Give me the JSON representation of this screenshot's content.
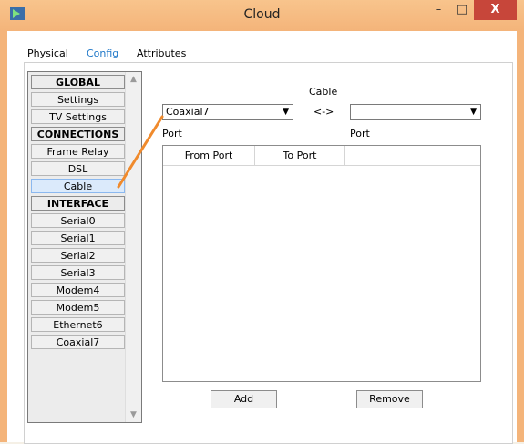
{
  "window": {
    "title": "Cloud",
    "minimize_glyph": "–",
    "maximize_glyph": "□",
    "close_glyph": "X"
  },
  "tabs": [
    {
      "label": "Physical"
    },
    {
      "label": "Config",
      "active": true
    },
    {
      "label": "Attributes"
    }
  ],
  "sidebar": {
    "items": [
      {
        "label": "GLOBAL",
        "type": "header"
      },
      {
        "label": "Settings"
      },
      {
        "label": "TV Settings"
      },
      {
        "label": "CONNECTIONS",
        "type": "header"
      },
      {
        "label": "Frame Relay"
      },
      {
        "label": "DSL"
      },
      {
        "label": "Cable",
        "selected": true
      },
      {
        "label": "INTERFACE",
        "type": "header"
      },
      {
        "label": "Serial0"
      },
      {
        "label": "Serial1"
      },
      {
        "label": "Serial2"
      },
      {
        "label": "Serial3"
      },
      {
        "label": "Modem4"
      },
      {
        "label": "Modem5"
      },
      {
        "label": "Ethernet6"
      },
      {
        "label": "Coaxial7"
      }
    ]
  },
  "main": {
    "cable_label": "Cable",
    "arrow_label": "<->",
    "left_select": {
      "value": "Coaxial7"
    },
    "right_select": {
      "value": ""
    },
    "port_left": "Port",
    "port_right": "Port",
    "table": {
      "columns": [
        "From Port",
        "To Port"
      ],
      "rows": []
    },
    "add_button": "Add",
    "remove_button": "Remove"
  },
  "colors": {
    "title_bar": "#f4b47a",
    "close_button": "#c7463a",
    "active_tab": "#1e77c8",
    "annotation_line": "#f08a2c"
  }
}
